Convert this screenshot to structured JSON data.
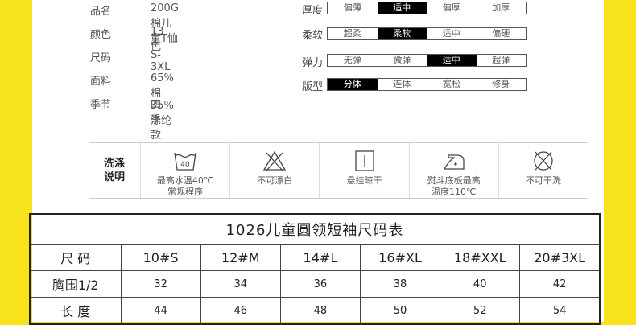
{
  "info": [
    {
      "label": "品名",
      "value": "200G棉儿童T恤"
    },
    {
      "label": "颜色",
      "value": "13色"
    },
    {
      "label": "尺码",
      "value": "S-3XL"
    },
    {
      "label": "面料",
      "value": "65%棉35%涤纶"
    },
    {
      "label": "季节",
      "value": "四季款"
    }
  ],
  "attributes": [
    {
      "label": "厚度",
      "options": [
        "偏薄",
        "适中",
        "偏厚",
        "加厚"
      ],
      "selected": "适中"
    },
    {
      "label": "柔软",
      "options": [
        "超柔",
        "柔软",
        "适中",
        "偏硬"
      ],
      "selected": "柔软"
    },
    {
      "label": "弹力",
      "options": [
        "无弹",
        "微弹",
        "适中",
        "超弹"
      ],
      "selected": "适中"
    },
    {
      "label": "版型",
      "options": [
        "分体",
        "连体",
        "宽松",
        "修身"
      ],
      "selected": "分体"
    }
  ],
  "washing": {
    "title_line1": "洗涤",
    "title_line2": "说明",
    "items": [
      {
        "icon": "wash-40-icon",
        "line1": "最高水温40℃",
        "line2": "常规程序",
        "temp": "40"
      },
      {
        "icon": "no-bleach-icon",
        "line1": "不可漂白",
        "line2": ""
      },
      {
        "icon": "hang-dry-icon",
        "line1": "悬挂晾干",
        "line2": ""
      },
      {
        "icon": "iron-icon",
        "line1": "熨斗底板最高",
        "line2": "温度110℃"
      },
      {
        "icon": "no-dry-clean-icon",
        "line1": "不可干洗",
        "line2": ""
      }
    ]
  },
  "size_table": {
    "title": "1026儿童圆领短袖尺码表",
    "header": [
      "尺 码",
      "10#S",
      "12#M",
      "14#L",
      "16#XL",
      "18#XXL",
      "20#3XL"
    ],
    "rows": [
      [
        "胸围1/2",
        "32",
        "34",
        "36",
        "38",
        "40",
        "42"
      ],
      [
        "长 度",
        "44",
        "46",
        "48",
        "50",
        "52",
        "54"
      ]
    ]
  }
}
